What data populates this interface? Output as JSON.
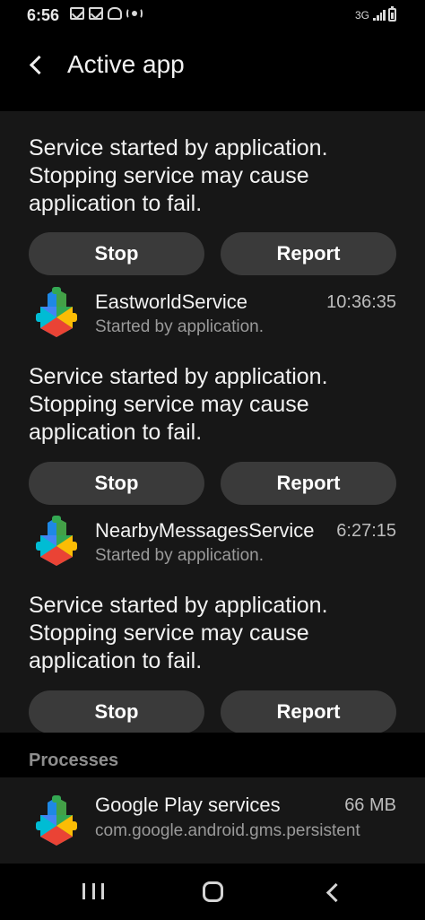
{
  "status_bar": {
    "time": "6:56",
    "network": "3G",
    "icons": [
      "gmail-icon",
      "gmail-icon",
      "incognito-icon",
      "hotspot-icon",
      "signal-icon",
      "battery-icon"
    ]
  },
  "header": {
    "title": "Active app",
    "back_icon": "chevron-left-icon"
  },
  "services": [
    {
      "warning": "Service started by application. Stopping service may cause application to fail.",
      "stop_label": "Stop",
      "report_label": "Report",
      "name": "EastworldService",
      "subtitle": "Started by application.",
      "time": "10:36:35",
      "icon": "google-play-services-icon"
    },
    {
      "warning": "Service started by application. Stopping service may cause application to fail.",
      "stop_label": "Stop",
      "report_label": "Report",
      "name": "NearbyMessagesService",
      "subtitle": "Started by application.",
      "time": "6:27:15",
      "icon": "google-play-services-icon"
    },
    {
      "warning": "Service started by application. Stopping service may cause application to fail.",
      "stop_label": "Stop",
      "report_label": "Report"
    }
  ],
  "processes": {
    "header": "Processes",
    "items": [
      {
        "name": "Google Play services",
        "package": "com.google.android.gms.persistent",
        "size": "66 MB",
        "icon": "google-play-services-icon"
      }
    ]
  },
  "nav_bar": {
    "buttons": [
      "recents-icon",
      "home-icon",
      "back-icon"
    ]
  },
  "colors": {
    "background": "#171717",
    "button": "#3a3a3a",
    "subtext": "#9a9a9a",
    "icon_blue": "#4285F4",
    "icon_green": "#34A853",
    "icon_yellow": "#FBBC05",
    "icon_red": "#EA4335"
  }
}
